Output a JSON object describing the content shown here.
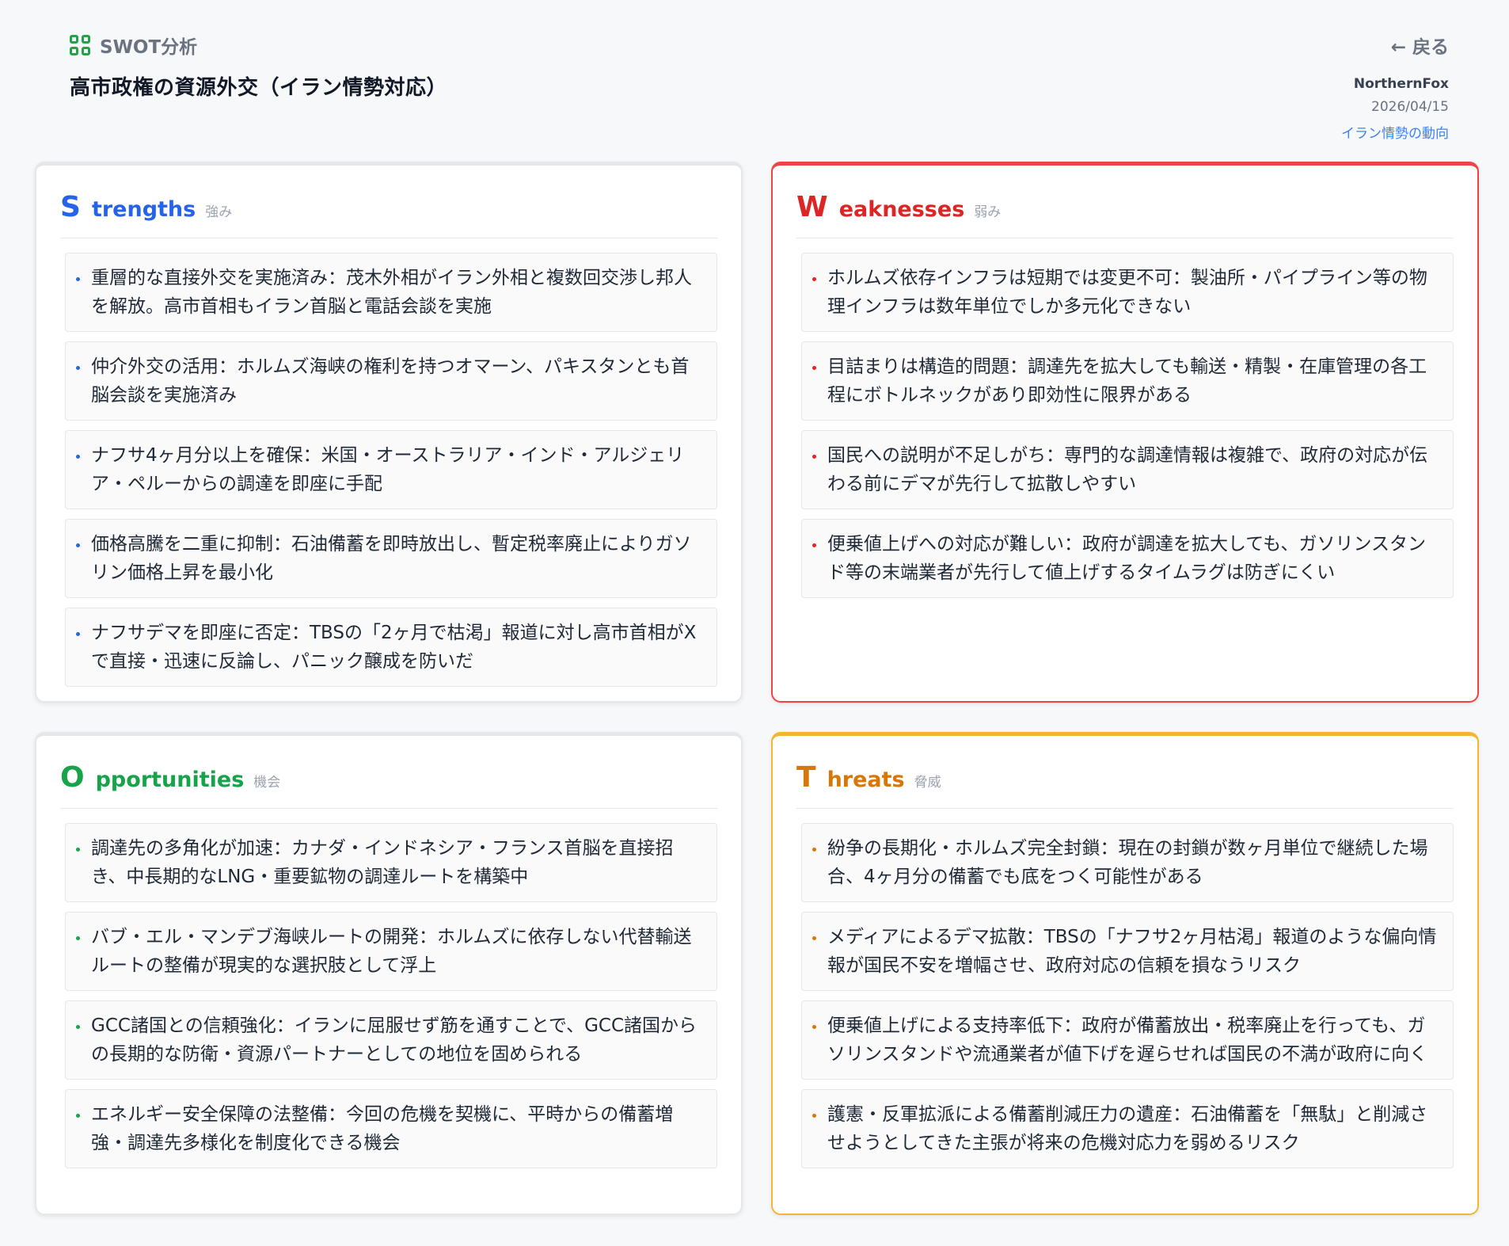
{
  "app": {
    "label": "SWOT分析",
    "icon": "grid-icon"
  },
  "page": {
    "title": "高市政権の資源外交（イラン情勢対応）",
    "back_label": "← 戻る"
  },
  "meta": {
    "author": "NorthernFox",
    "date": "2026/04/15",
    "topic": "イラン情勢の動向"
  },
  "colors": {
    "strengths": "#2563eb",
    "weaknesses": "#dc2626",
    "opportunities": "#16a34a",
    "threats": "#d97706"
  },
  "strengths": {
    "letter": "S",
    "word": "trengths",
    "jp": "強み",
    "items": [
      "重層的な直接外交を実施済み：茂木外相がイラン外相と複数回交渉し邦人を解放。高市首相もイラン首脳と電話会談を実施",
      "仲介外交の活用：ホルムズ海峡の権利を持つオマーン、パキスタンとも首脳会談を実施済み",
      "ナフサ4ヶ月分以上を確保：米国・オーストラリア・インド・アルジェリア・ペルーからの調達を即座に手配",
      "価格高騰を二重に抑制：石油備蓄を即時放出し、暫定税率廃止によりガソリン価格上昇を最小化",
      "ナフサデマを即座に否定：TBSの「2ヶ月で枯渇」報道に対し高市首相がXで直接・迅速に反論し、パニック醸成を防いだ"
    ]
  },
  "weaknesses": {
    "letter": "W",
    "word": "eaknesses",
    "jp": "弱み",
    "items": [
      "ホルムズ依存インフラは短期では変更不可：製油所・パイプライン等の物理インフラは数年単位でしか多元化できない",
      "目詰まりは構造的問題：調達先を拡大しても輸送・精製・在庫管理の各工程にボトルネックがあり即効性に限界がある",
      "国民への説明が不足しがち：専門的な調達情報は複雑で、政府の対応が伝わる前にデマが先行して拡散しやすい",
      "便乗値上げへの対応が難しい：政府が調達を拡大しても、ガソリンスタンド等の末端業者が先行して値上げするタイムラグは防ぎにくい"
    ]
  },
  "opportunities": {
    "letter": "O",
    "word": "pportunities",
    "jp": "機会",
    "items": [
      "調達先の多角化が加速：カナダ・インドネシア・フランス首脳を直接招き、中長期的なLNG・重要鉱物の調達ルートを構築中",
      "バブ・エル・マンデブ海峡ルートの開発：ホルムズに依存しない代替輸送ルートの整備が現実的な選択肢として浮上",
      "GCC諸国との信頼強化：イランに屈服せず筋を通すことで、GCC諸国からの長期的な防衛・資源パートナーとしての地位を固められる",
      "エネルギー安全保障の法整備：今回の危機を契機に、平時からの備蓄増強・調達先多様化を制度化できる機会"
    ]
  },
  "threats": {
    "letter": "T",
    "word": "hreats",
    "jp": "脅威",
    "items": [
      "紛争の長期化・ホルムズ完全封鎖：現在の封鎖が数ヶ月単位で継続した場合、4ヶ月分の備蓄でも底をつく可能性がある",
      "メディアによるデマ拡散：TBSの「ナフサ2ヶ月枯渇」報道のような偏向情報が国民不安を増幅させ、政府対応の信頼を損なうリスク",
      "便乗値上げによる支持率低下：政府が備蓄放出・税率廃止を行っても、ガソリンスタンドや流通業者が値下げを遅らせれば国民の不満が政府に向く",
      "護憲・反軍拡派による備蓄削減圧力の遺産：石油備蓄を「無駄」と削減させようとしてきた主張が将来の危機対応力を弱めるリスク"
    ]
  }
}
